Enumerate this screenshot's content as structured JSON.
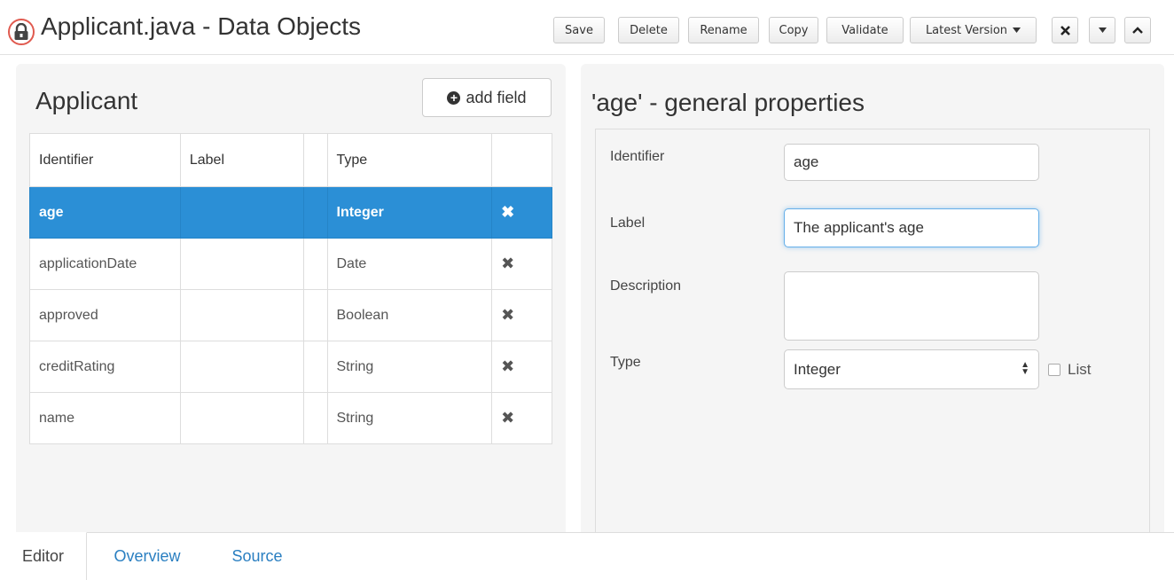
{
  "window": {
    "title": "Applicant.java - Data Objects",
    "toolbar": {
      "save": "Save",
      "delete": "Delete",
      "rename": "Rename",
      "copy": "Copy",
      "validate": "Validate",
      "latest_version": "Latest Version"
    }
  },
  "left": {
    "title": "Applicant",
    "add_field": "add field",
    "columns": [
      "Identifier",
      "Label",
      "",
      "Type",
      ""
    ],
    "rows": [
      {
        "identifier": "age",
        "label": "",
        "type": "Integer",
        "selected": true
      },
      {
        "identifier": "applicationDate",
        "label": "",
        "type": "Date",
        "selected": false
      },
      {
        "identifier": "approved",
        "label": "",
        "type": "Boolean",
        "selected": false
      },
      {
        "identifier": "creditRating",
        "label": "",
        "type": "String",
        "selected": false
      },
      {
        "identifier": "name",
        "label": "",
        "type": "String",
        "selected": false
      }
    ]
  },
  "right": {
    "title": "'age' - general properties",
    "identifier_label": "Identifier",
    "identifier_value": "age",
    "label_label": "Label",
    "label_value": "The applicant's age",
    "description_label": "Description",
    "description_value": "",
    "type_label": "Type",
    "type_value": "Integer",
    "list_label": "List",
    "list_checked": false
  },
  "tabs": {
    "editor": "Editor",
    "overview": "Overview",
    "source": "Source"
  },
  "colors": {
    "selected_row": "#2b8fd6",
    "link": "#2a7fc1",
    "lock_highlight": "#e05a4f"
  }
}
